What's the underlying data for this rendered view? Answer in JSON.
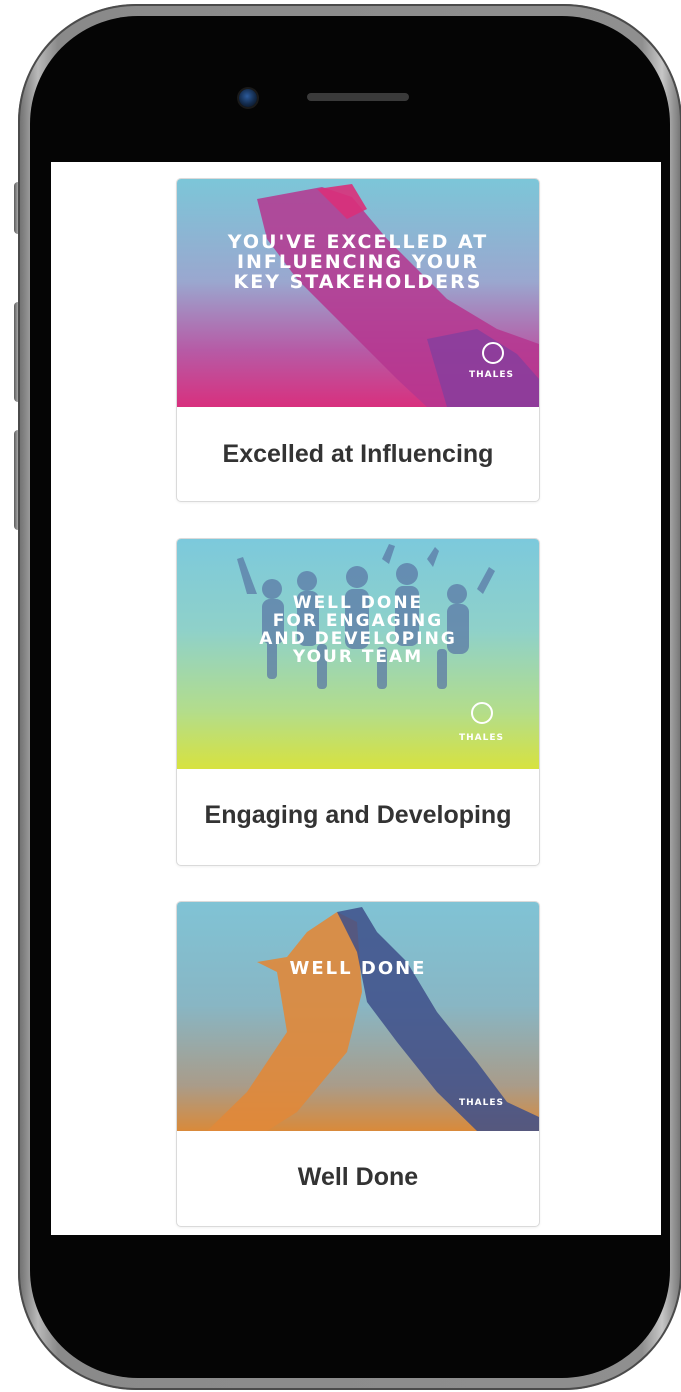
{
  "cards": [
    {
      "image_text": "YOU'VE EXCELLED AT\nINFLUENCING YOUR\nKEY STAKEHOLDERS",
      "brand": "THALES",
      "title": "Excelled at Influencing"
    },
    {
      "image_text": "WELL DONE\nFOR ENGAGING\nAND DEVELOPING\nYOUR TEAM",
      "brand": "THALES",
      "title": "Engaging and Developing"
    },
    {
      "image_text": "WELL DONE",
      "brand": "THALES",
      "title": "Well Done"
    }
  ],
  "colors": {
    "card1_gradient": [
      "#7cc6d8",
      "#b65ba6",
      "#d8307e"
    ],
    "card2_gradient": [
      "#7cc9dc",
      "#9fd6b4",
      "#d7e23f"
    ],
    "card3_gradient": [
      "#80c3d5",
      "#8a9ea4",
      "#d98a3a"
    ],
    "title_text": "#333333"
  }
}
